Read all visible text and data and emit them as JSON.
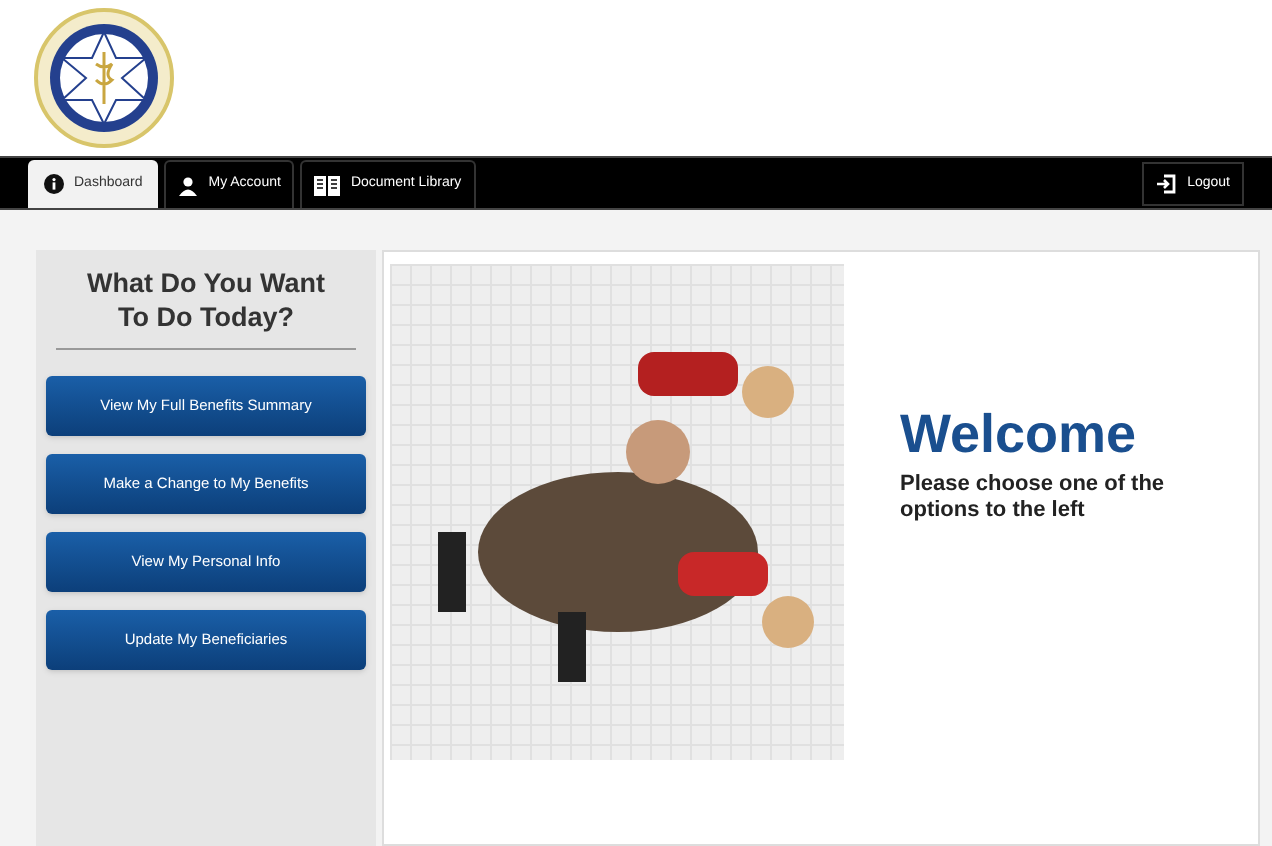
{
  "nav": {
    "tabs": [
      {
        "label": "Dashboard",
        "kind": "info",
        "selected": true
      },
      {
        "label": "My Account",
        "kind": "user",
        "selected": false
      },
      {
        "label": "Document Library",
        "kind": "library",
        "selected": false
      }
    ],
    "logout": "Logout"
  },
  "sidebar": {
    "heading": "What Do You Want To Do Today?",
    "buttons": [
      "View My Full Benefits Summary",
      "Make a Change to My Benefits",
      "View My Personal Info",
      "Update My Beneficiaries"
    ]
  },
  "main": {
    "title": "Welcome",
    "message": "Please choose one of the options to the left"
  }
}
